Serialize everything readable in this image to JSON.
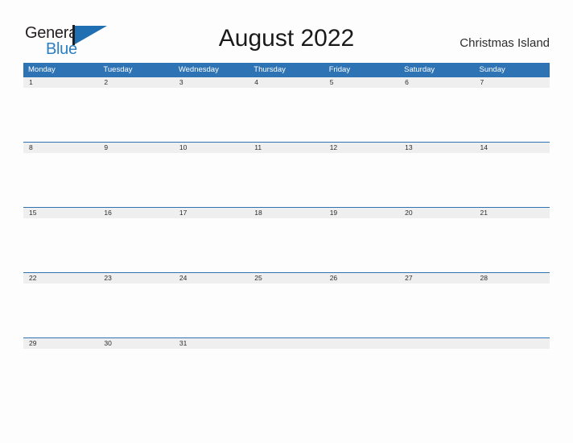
{
  "brand": {
    "name_part1": "General",
    "name_part2": "Blue",
    "mark": "flag-triangle-icon"
  },
  "header": {
    "title": "August 2022",
    "location": "Christmas Island"
  },
  "calendar": {
    "month": "August",
    "year": "2022",
    "weekday_headers": [
      "Monday",
      "Tuesday",
      "Wednesday",
      "Thursday",
      "Friday",
      "Saturday",
      "Sunday"
    ],
    "weeks": [
      {
        "days": [
          "1",
          "2",
          "3",
          "4",
          "5",
          "6",
          "7"
        ]
      },
      {
        "days": [
          "8",
          "9",
          "10",
          "11",
          "12",
          "13",
          "14"
        ]
      },
      {
        "days": [
          "15",
          "16",
          "17",
          "18",
          "19",
          "20",
          "21"
        ]
      },
      {
        "days": [
          "22",
          "23",
          "24",
          "25",
          "26",
          "27",
          "28"
        ]
      },
      {
        "days": [
          "29",
          "30",
          "31",
          "",
          "",
          "",
          ""
        ]
      }
    ]
  },
  "colors": {
    "header_blue": "#2e74b5",
    "number_band_gray": "#efefef",
    "brand_blue": "#2b7ec1",
    "page_background": "#fdfdfd",
    "text_dark": "#1a1a1a"
  }
}
